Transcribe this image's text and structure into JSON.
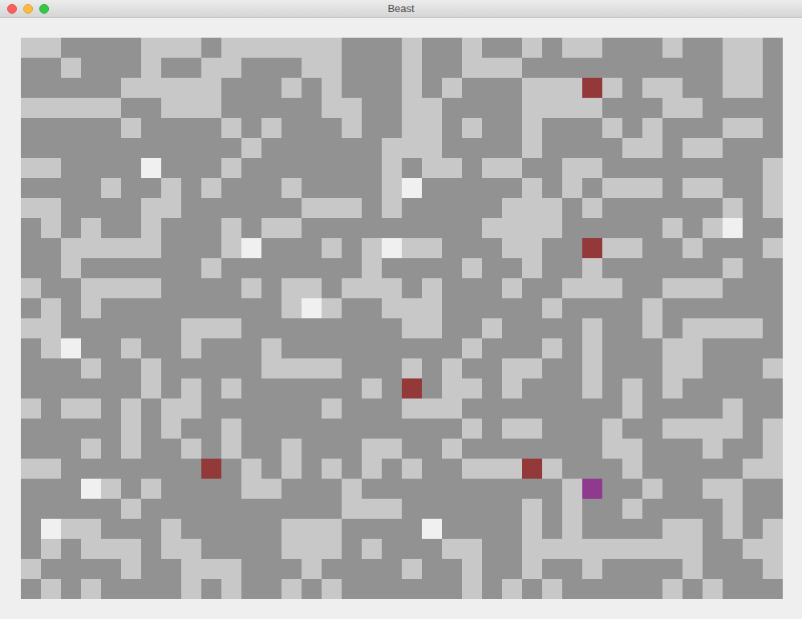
{
  "window": {
    "title": "Beast"
  },
  "board": {
    "columns": 38,
    "rows": [
      "##....###.######...#..#..#.##...#..##.",
      "..#...#..##...##...#..###..........##.",
      ".....#####...#.#...#.#...###B#.##..##.",
      "#####..###.....##..##....####...##....",
      ".....#....#.#...#..##.#..#...#.#...##.",
      "...........#......###....#....##.##...",
      "##....E...#.......#.##.##..##........#",
      "....#..#.#...#....#E.....#.#.###.##..#",
      "##....##......###.#.....###.#......#.#",
      ".#.#..#...#.##.........####.....#.#E..",
      "..#####...#E...#.#E##...##..B##..#...#",
      "..#......#.......#....#..#..#......#..",
      "#..####....#.##.###.#...#..###..###...",
      ".#.#.........#E#..###.....#....#......",
      "##......###........##..#....#..#.####.",
      ".#E..#..#...#.........#...#.#...##....",
      "...#..#.....####...#.#..##..#...##...#",
      "......#.#.#......#.B.##.#...#.#.#.....",
      "#.##.#.##......#...###........#....#..",
      ".....#.#..#...........#.##...#..####.#.",
      "...#.#..#.#..#...##..#.......##...#..#",
      "##.......B.#.#.#.#.#..###B#...#.....##",
      "...E#.#....##...#..........#P..#..##..",
      ".....#..........###......#.#..#....#..",
      ".E##...#.....###....E....#.#....##.#.#",
      ".#.###.##....###.#...##..#########..##",
      "#....#..###...#....#..#..#..#....#...#",
      ".#.#....#.#..#.#......#.#.#.....#.#..."
    ]
  },
  "legend": [
    {
      "symbol": ".",
      "kind": "empty",
      "color": "#929292"
    },
    {
      "symbol": "#",
      "kind": "block",
      "color": "#c8c8c8"
    },
    {
      "symbol": "B",
      "kind": "beast",
      "color": "#943939"
    },
    {
      "symbol": "P",
      "kind": "player",
      "color": "#8e3a8e"
    },
    {
      "symbol": "E",
      "kind": "egg",
      "color": "#f0f0f0"
    }
  ]
}
